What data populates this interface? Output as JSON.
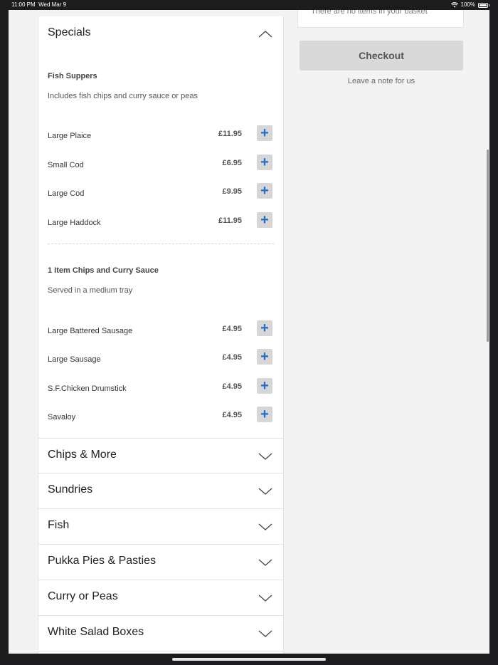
{
  "status_bar": {
    "time": "11:00 PM",
    "date": "Wed Mar 9",
    "battery": "100%"
  },
  "basket": {
    "empty_text": "There are no items in your basket",
    "checkout_label": "Checkout",
    "note_label": "Leave a note for us"
  },
  "specials": {
    "title": "Specials",
    "groups": [
      {
        "title": "Fish Suppers",
        "description": "Includes fish chips and curry sauce or peas",
        "items": [
          {
            "name": "Large Plaice",
            "price": "£11.95"
          },
          {
            "name": "Small Cod",
            "price": "£6.95"
          },
          {
            "name": "Large Cod",
            "price": "£9.95"
          },
          {
            "name": "Large Haddock",
            "price": "£11.95"
          }
        ]
      },
      {
        "title": "1 Item Chips and Curry Sauce",
        "description": "Served in a medium tray",
        "items": [
          {
            "name": "Large Battered Sausage",
            "price": "£4.95"
          },
          {
            "name": "Large Sausage",
            "price": "£4.95"
          },
          {
            "name": "S.F.Chicken Drumstick",
            "price": "£4.95"
          },
          {
            "name": "Savaloy",
            "price": "£4.95"
          }
        ]
      }
    ]
  },
  "add_symbol": "+",
  "categories": [
    "Chips & More",
    "Sundries",
    "Fish",
    "Pukka Pies & Pasties",
    "Curry or Peas",
    "White Salad Boxes"
  ],
  "icons": {
    "expand": "chevron-down-icon",
    "collapse": "chevron-up-icon",
    "add": "plus-icon"
  },
  "colors": {
    "accent": "#1f6fd1",
    "button_bg": "#d6d6d6",
    "checkout_bg": "#d9d9d9"
  }
}
